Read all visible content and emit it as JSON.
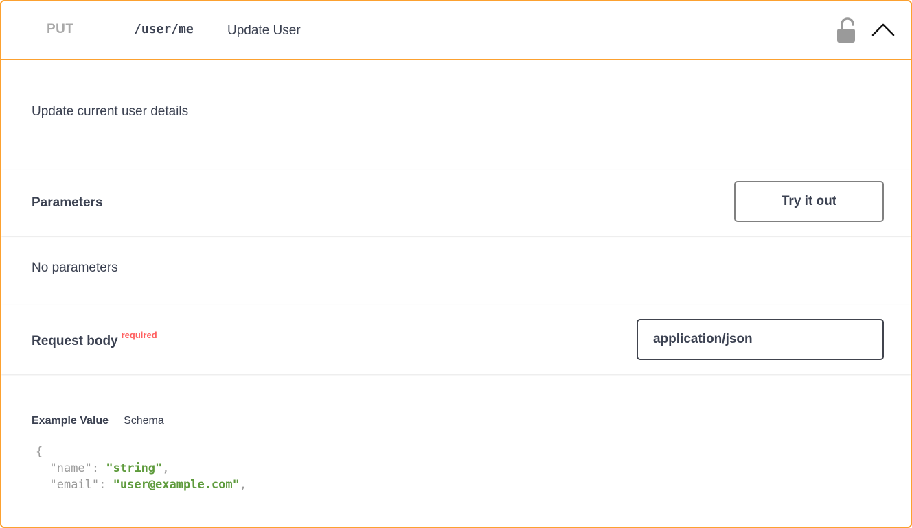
{
  "operation": {
    "method": "PUT",
    "path": "/user/me",
    "summary": "Update User",
    "description": "Update current user details"
  },
  "colors": {
    "accent": "#fca130",
    "required": "#ff6060",
    "text": "#3b4151",
    "string_value": "#5e9b3c"
  },
  "icons": {
    "lock": "unlocked-padlock-icon",
    "toggle": "chevron-up-icon"
  },
  "parameters": {
    "title": "Parameters",
    "try_label": "Try it out",
    "empty_text": "No parameters"
  },
  "request_body": {
    "title": "Request body",
    "required_label": "required",
    "content_type": "application/json"
  },
  "example": {
    "tab_example": "Example Value",
    "tab_schema": "Schema",
    "open_brace": "{",
    "fields": [
      {
        "key": "\"name\"",
        "value": "\"string\""
      },
      {
        "key": "\"email\"",
        "value": "\"user@example.com\""
      }
    ]
  }
}
